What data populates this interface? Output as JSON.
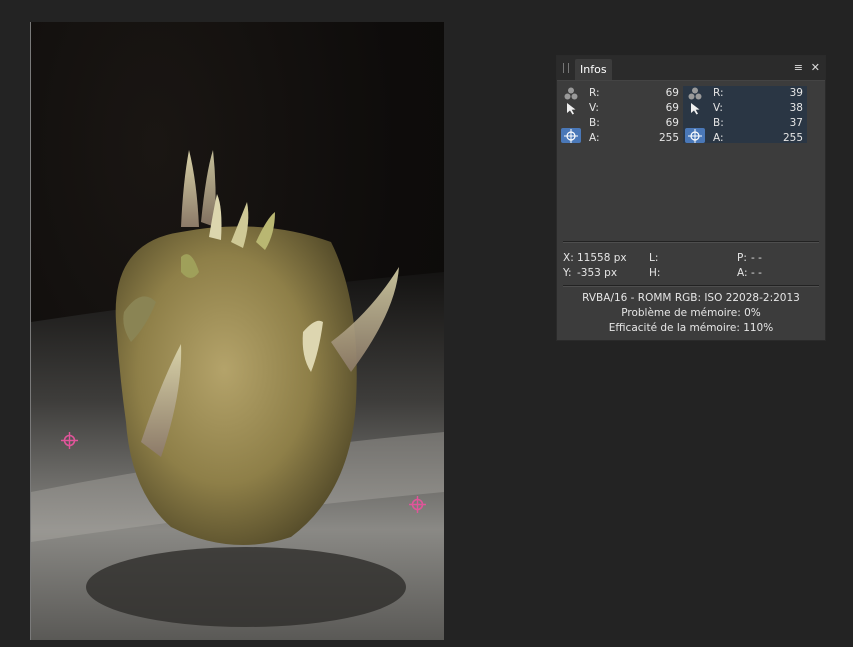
{
  "panel": {
    "tab_label": "Infos",
    "menu_glyph": "≡",
    "close_glyph": "✕"
  },
  "sampler_left": {
    "channels": [
      {
        "label": "R:",
        "value": "69"
      },
      {
        "label": "V:",
        "value": "69"
      },
      {
        "label": "B:",
        "value": "69"
      },
      {
        "label": "A:",
        "value": "255"
      }
    ]
  },
  "sampler_right": {
    "channels": [
      {
        "label": "R:",
        "value": "39"
      },
      {
        "label": "V:",
        "value": "38"
      },
      {
        "label": "B:",
        "value": "37"
      },
      {
        "label": "A:",
        "value": "255"
      }
    ]
  },
  "coords": {
    "x_label": "X:",
    "x_value": "11558 px",
    "y_label": "Y:",
    "y_value": "-353 px",
    "l_label": "L:",
    "h_label": "H:",
    "p_label": "P:",
    "p_value": "- -",
    "a_label": "A:",
    "a_value": "- -"
  },
  "footer": {
    "color_format": "RVBA/16 - ROMM RGB: ISO 22028-2:2013",
    "memory_problem": "Problème de mémoire: 0%",
    "memory_efficiency": "Efficacité de la mémoire: 110%"
  },
  "icons": {
    "channels": "color-channels-icon",
    "pointer": "pointer-icon",
    "crosshair": "crosshair-icon"
  },
  "colors": {
    "sampler_marker": "#e0559a",
    "active_icon_bg": "#4a78b8",
    "right_block_bg": "#2a3644"
  }
}
